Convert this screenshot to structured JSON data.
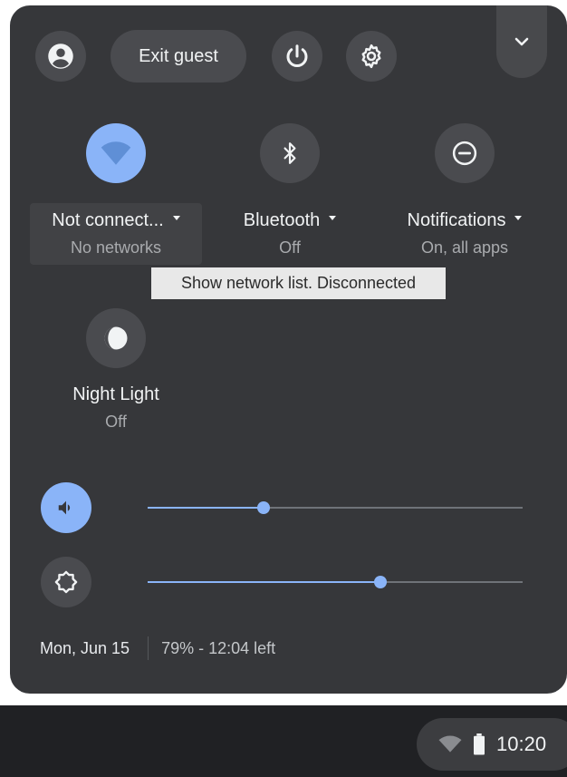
{
  "top_row": {
    "exit_guest_label": "Exit guest"
  },
  "features": {
    "network": {
      "label": "Not connect...",
      "sub": "No networks"
    },
    "bluetooth": {
      "label": "Bluetooth",
      "sub": "Off"
    },
    "notifications": {
      "label": "Notifications",
      "sub": "On, all apps"
    },
    "night_light": {
      "label": "Night Light",
      "sub": "Off"
    }
  },
  "tooltip": "Show network list. Disconnected",
  "sliders": {
    "volume_level": 0.31,
    "brightness_level": 0.62
  },
  "footer": {
    "date": "Mon, Jun 15",
    "battery": "79% - 12:04 left"
  },
  "shelf": {
    "time": "10:20"
  },
  "colors": {
    "panel": "#36373a",
    "accent": "#8ab4f8",
    "shelf": "#202124"
  },
  "icons": [
    "account-icon",
    "power-icon",
    "settings-icon",
    "chevron-down-icon",
    "wifi-icon",
    "bluetooth-icon",
    "do-not-disturb-icon",
    "night-light-icon",
    "volume-icon",
    "brightness-icon",
    "battery-icon"
  ]
}
